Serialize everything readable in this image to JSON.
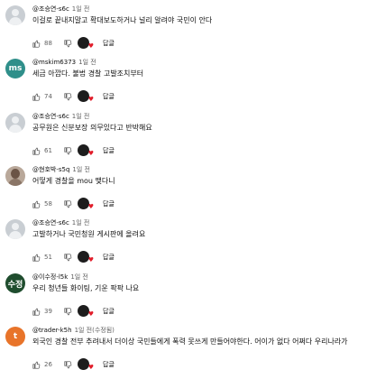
{
  "reply_label": "답글",
  "heart_color": "#e11d2a",
  "comments": [
    {
      "author": "@조승연-s6c",
      "time": "1일 전",
      "text": "이걸로 끝내지말고   확대보도하거나   널리 알려야 국민이 안다",
      "likes": "88",
      "avatar": {
        "type": "default",
        "text": ""
      }
    },
    {
      "author": "@mskim6373",
      "time": "1일 전",
      "text": "세금 아깝다. 불법 경찰 고발조치부터",
      "likes": "74",
      "avatar": {
        "type": "letters",
        "text": "ms",
        "color": "#2f8f8a"
      }
    },
    {
      "author": "@조승연-s6c",
      "time": "1일 전",
      "text": "공무원은 신분보장 의무있다고   반박해요",
      "likes": "61",
      "avatar": {
        "type": "default",
        "text": ""
      }
    },
    {
      "author": "@현호박-s5q",
      "time": "1일 전",
      "text": "어떻게 경찰을 mou 맺다니",
      "likes": "58",
      "avatar": {
        "type": "photo",
        "text": ""
      }
    },
    {
      "author": "@조승연-s6c",
      "time": "1일 전",
      "text": "고발하거나    국민청원 게시판에 올려요",
      "likes": "51",
      "avatar": {
        "type": "default",
        "text": ""
      }
    },
    {
      "author": "@이수정-l5k",
      "time": "1일 전",
      "text": "우리 청년들 화이팅,  기운 팍팍 나요",
      "likes": "39",
      "avatar": {
        "type": "letters",
        "text": "수정",
        "color": "#1f4d2e"
      }
    },
    {
      "author": "@trader-k5h",
      "time": "1일 전(수정됨)",
      "text": "외국인 경찰 전부 추려내서 더이상 국민들에게 폭력 못쓰게 만들어야한다. 어이가 없다 어쩌다 우리나라가",
      "likes": "26",
      "avatar": {
        "type": "letters",
        "text": "t",
        "color": "#e8742a"
      }
    }
  ]
}
